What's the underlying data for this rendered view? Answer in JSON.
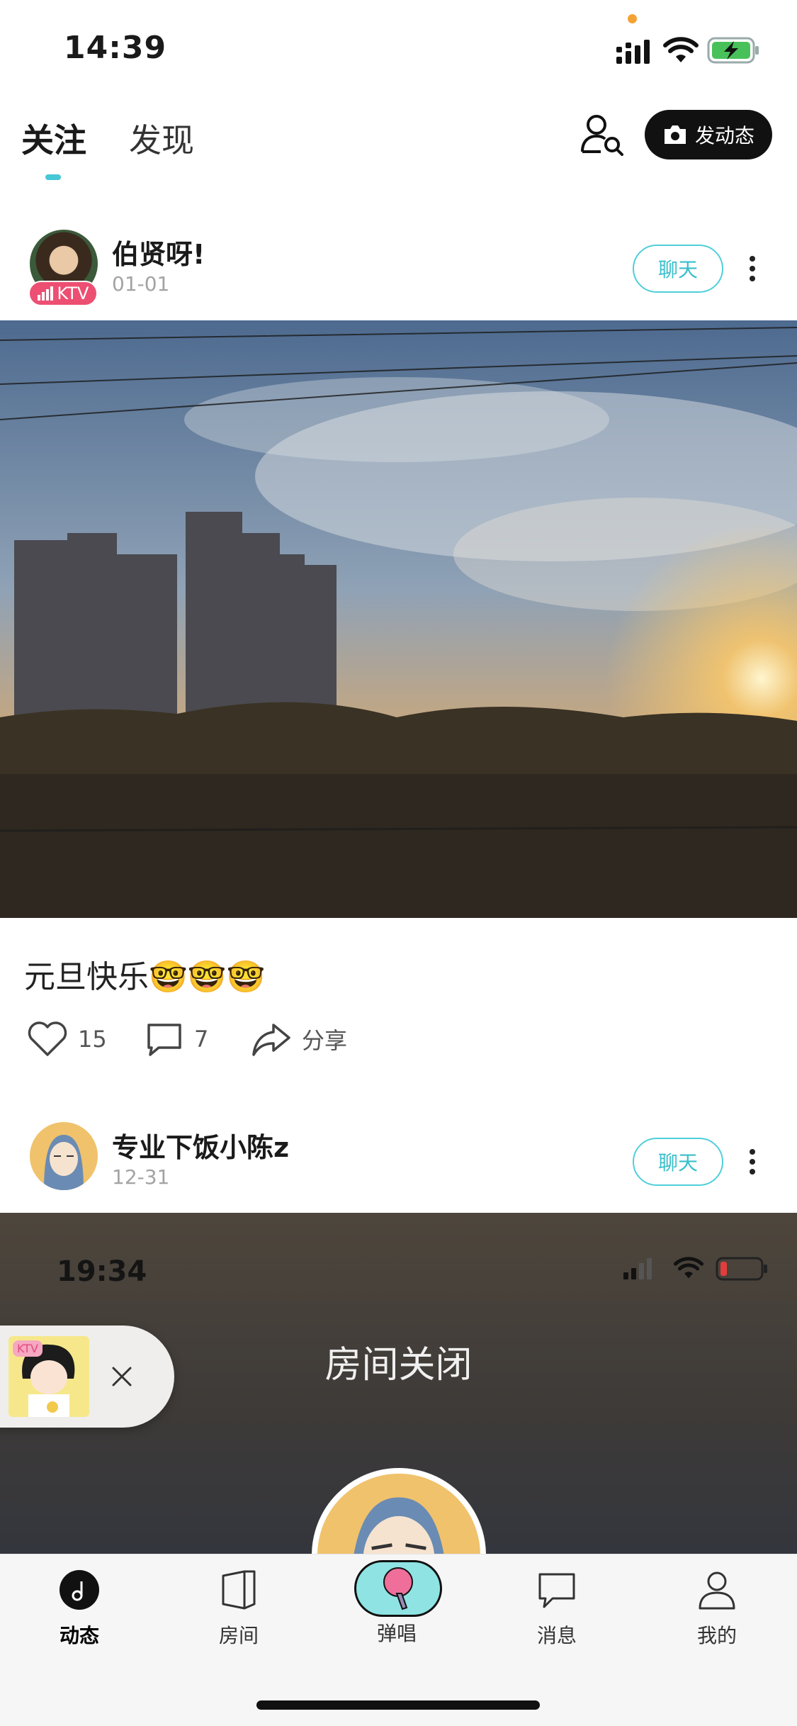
{
  "status_bar": {
    "time": "14:39"
  },
  "header": {
    "tabs": [
      {
        "label": "关注",
        "active": true
      },
      {
        "label": "发现",
        "active": false
      }
    ],
    "post_button_label": "发动态"
  },
  "posts": [
    {
      "username": "伯贤呀!",
      "date": "01-01",
      "badge": "KTV",
      "chat_label": "聊天",
      "caption": "元旦快乐🤓🤓🤓",
      "likes": "15",
      "comments": "7",
      "share_label": "分享"
    },
    {
      "username": "专业下饭小陈z",
      "date": "12-31",
      "chat_label": "聊天",
      "image": {
        "time": "19:34",
        "title": "房间关闭"
      }
    }
  ],
  "floating_ktv": {
    "badge": "KTV"
  },
  "bottom_nav": [
    {
      "label": "动态",
      "icon": "music-note-icon",
      "active": true
    },
    {
      "label": "房间",
      "icon": "room-icon",
      "active": false
    },
    {
      "label": "弹唱",
      "icon": "microphone-icon",
      "active": false
    },
    {
      "label": "消息",
      "icon": "message-icon",
      "active": false
    },
    {
      "label": "我的",
      "icon": "profile-icon",
      "active": false
    }
  ],
  "colors": {
    "accent": "#46c8d6",
    "badge": "#ec4f72",
    "mic_bg": "#8fe3e3"
  }
}
